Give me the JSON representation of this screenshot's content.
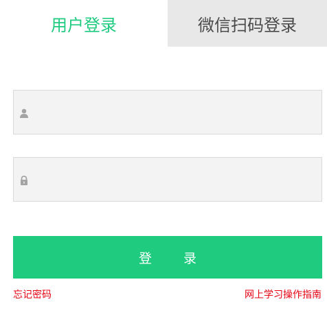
{
  "tabs": {
    "account_login": "用户登录",
    "wechat_login": "微信扫码登录"
  },
  "form": {
    "username": {
      "value": "",
      "placeholder": "",
      "icon": "user-icon"
    },
    "password": {
      "value": "",
      "placeholder": "",
      "icon": "lock-icon"
    },
    "submit_label": "登 录"
  },
  "links": {
    "forgot_password": "忘记密码",
    "guide": "网上学习操作指南"
  },
  "colors": {
    "accent": "#1ecb7f",
    "link": "#e60012",
    "inactive_tab_bg": "#e8e8e8",
    "field_bg": "#f3f3f3"
  }
}
